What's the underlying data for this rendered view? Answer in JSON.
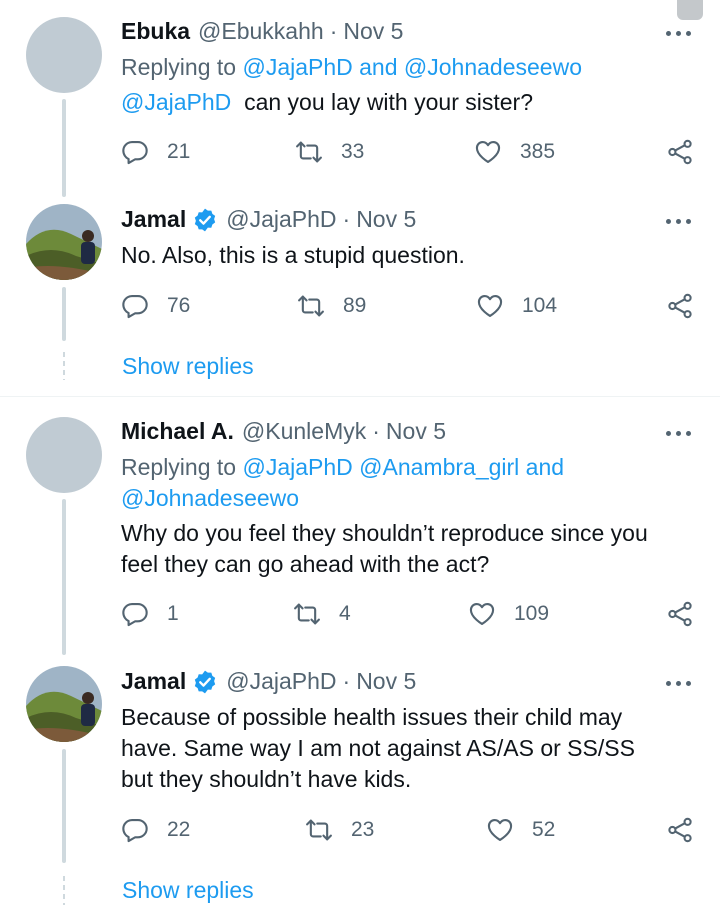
{
  "tweets": [
    {
      "name": "Ebuka",
      "handle": "@Ebukkahh",
      "date": "Nov 5",
      "reply_prefix": "Replying to",
      "reply_line1": "@JajaPhD and @Johnadeseewo",
      "text_mention": "@JajaPhD",
      "text_rest": "  can you lay with your sister?",
      "replies": "21",
      "retweets": "33",
      "likes": "385"
    },
    {
      "name": "Jamal",
      "handle": "@JajaPhD",
      "date": "Nov 5",
      "text": "No. Also, this is a stupid question.",
      "replies": "76",
      "retweets": "89",
      "likes": "104",
      "show_replies": "Show replies"
    },
    {
      "name": "Michael A.",
      "handle": "@KunleMyk",
      "date": "Nov 5",
      "reply_prefix": "Replying to",
      "reply_line1": "@JajaPhD @Anambra_girl and",
      "reply_line2": "@Johnadeseewo",
      "text_line1": "Why do you feel they shouldn’t reproduce since you",
      "text_line2": "feel they can go ahead with the act?",
      "replies": "1",
      "retweets": "4",
      "likes": "109"
    },
    {
      "name": "Jamal",
      "handle": "@JajaPhD",
      "date": "Nov 5",
      "text_line1": "Because of possible health issues their child may",
      "text_line2": "have. Same way I am not against AS/AS or SS/SS",
      "text_line3": "but they shouldn’t have kids.",
      "replies": "22",
      "retweets": "23",
      "likes": "52",
      "show_replies": "Show replies"
    }
  ],
  "separator": "·",
  "colors": {
    "link": "#1d9bf0",
    "muted": "#536471",
    "verified": "#1d9bf0"
  }
}
